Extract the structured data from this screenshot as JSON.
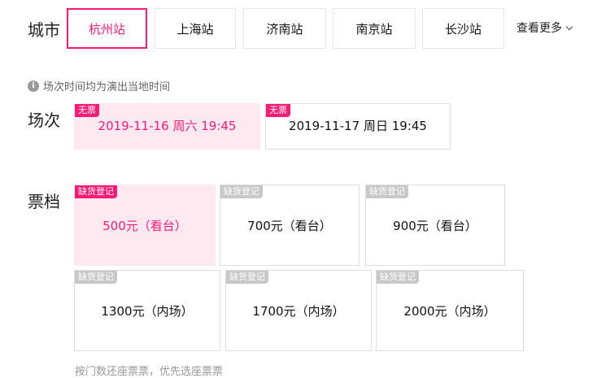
{
  "city": {
    "label": "城市",
    "tabs": [
      "杭州站",
      "上海站",
      "济南站",
      "南京站",
      "长沙站"
    ],
    "more_label": "查看更多"
  },
  "note": {
    "icon": "info-icon",
    "text": "场次时间均为演出当地时间"
  },
  "session": {
    "label": "场次",
    "items": [
      {
        "badge": "无票",
        "text": "2019-11-16 周六 19:45"
      },
      {
        "badge": "无票",
        "text": "2019-11-17 周日 19:45"
      }
    ]
  },
  "tier": {
    "label": "票档",
    "items": [
      {
        "badge": "缺货登记",
        "text": "500元（看台）"
      },
      {
        "badge": "缺货登记",
        "text": "700元（看台）"
      },
      {
        "badge": "缺货登记",
        "text": "900元（看台）"
      },
      {
        "badge": "缺货登记",
        "text": "1300元（内场）"
      },
      {
        "badge": "缺货登记",
        "text": "1700元（内场）"
      },
      {
        "badge": "缺货登记",
        "text": "2000元（内场）"
      }
    ]
  },
  "bottom_text": "按门数还座票票，优先选座票票",
  "colors": {
    "accent": "#ff1a75",
    "selected_bg": "#ffe9f0",
    "disabled_badge": "#c8c8c8"
  }
}
